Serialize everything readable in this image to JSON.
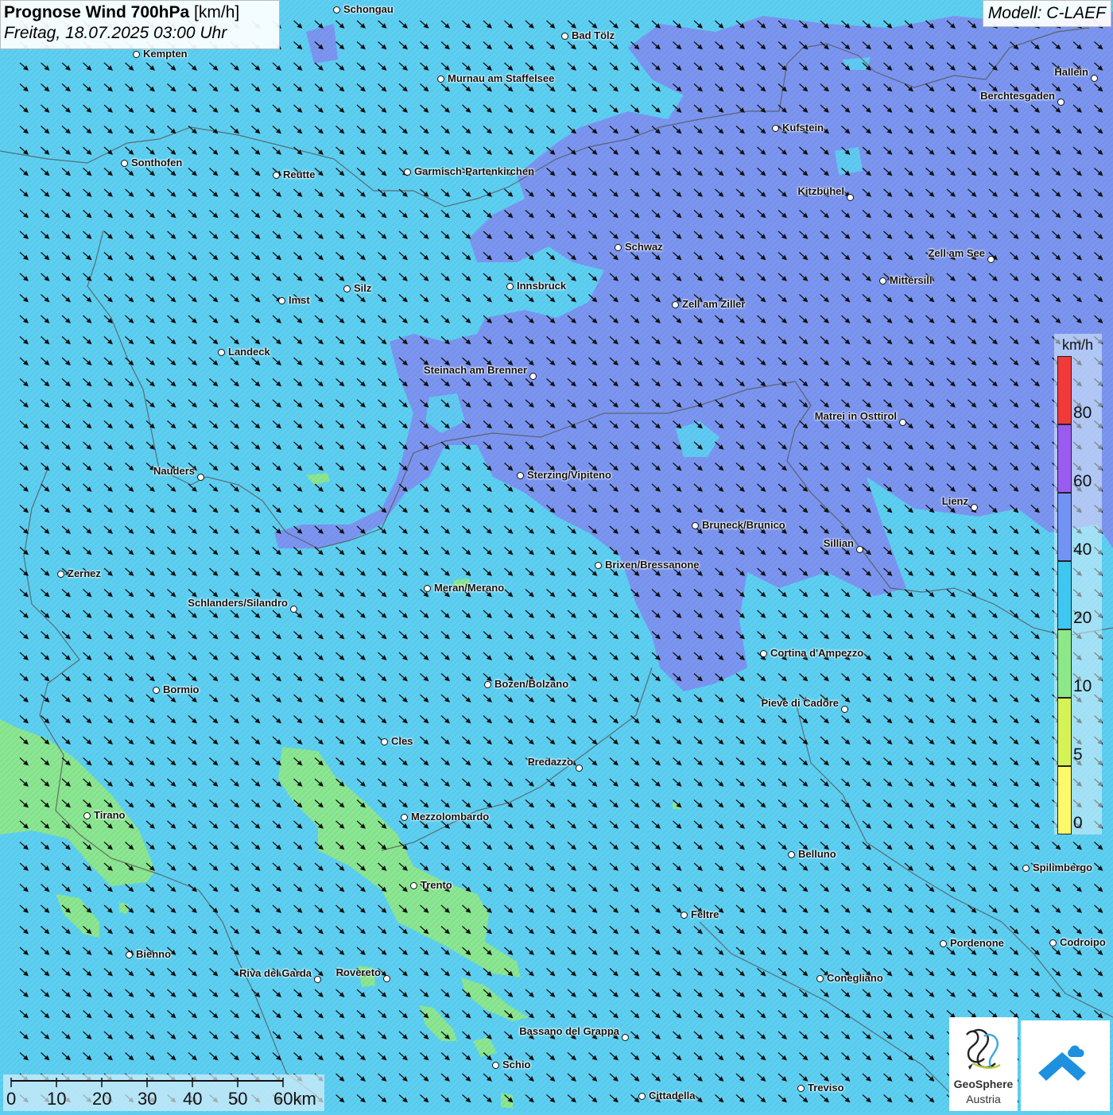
{
  "header": {
    "title_bold": "Prognose Wind 700hPa",
    "title_unit": " [km/h]",
    "subtitle": "Freitag, 18.07.2025 03:00 Uhr"
  },
  "model_label": "Modell: C-LAEF",
  "colors": {
    "base_20_40": "#5dd0f2",
    "band_40_60": "#7f8ff0",
    "band_10_20": "#8de88a",
    "band_5_10": "#d5f257",
    "band_0_5": "#fdf96b",
    "band_60_80": "#9a5cf0",
    "band_80_plus": "#f2393a"
  },
  "legend": {
    "unit": "km/h",
    "stops": [
      {
        "label": "0",
        "color": "#fdf96b"
      },
      {
        "label": "5",
        "color": "#d5f257"
      },
      {
        "label": "10",
        "color": "#8de88a"
      },
      {
        "label": "20",
        "color": "#3ec7f0"
      },
      {
        "label": "40",
        "color": "#7193f3"
      },
      {
        "label": "60",
        "color": "#9a5cf0"
      },
      {
        "label": "80",
        "color": "#f2393a"
      }
    ]
  },
  "wind_arrows": {
    "direction": "north-west wind (arrows pointing south-east)"
  },
  "cities": [
    {
      "name": "Schongau"
    },
    {
      "name": "Bad Tölz"
    },
    {
      "name": "Kempten"
    },
    {
      "name": "Murnau am Staffelsee"
    },
    {
      "name": "Hallein"
    },
    {
      "name": "Berchtesgaden"
    },
    {
      "name": "Kufstein"
    },
    {
      "name": "Sonthofen"
    },
    {
      "name": "Reutte"
    },
    {
      "name": "Garmisch-Partenkirchen"
    },
    {
      "name": "Kitzbühel"
    },
    {
      "name": "Schwaz"
    },
    {
      "name": "Zell am See"
    },
    {
      "name": "Mittersill"
    },
    {
      "name": "Innsbruck"
    },
    {
      "name": "Silz"
    },
    {
      "name": "Imst"
    },
    {
      "name": "Zell am Ziller"
    },
    {
      "name": "Landeck"
    },
    {
      "name": "Steinach am Brenner"
    },
    {
      "name": "Matrei in Osttirol"
    },
    {
      "name": "Nauders"
    },
    {
      "name": "Sterzing/Vipiteno"
    },
    {
      "name": "Lienz"
    },
    {
      "name": "Bruneck/Brunico"
    },
    {
      "name": "Sillian"
    },
    {
      "name": "Brixen/Bressanone"
    },
    {
      "name": "Zernez"
    },
    {
      "name": "Meran/Merano"
    },
    {
      "name": "Schlanders/Silandro"
    },
    {
      "name": "Cortina d'Ampezzo"
    },
    {
      "name": "Bozen/Bolzano"
    },
    {
      "name": "Bormio"
    },
    {
      "name": "Pieve di Cadore"
    },
    {
      "name": "Cles"
    },
    {
      "name": "Predazzo"
    },
    {
      "name": "Tirano"
    },
    {
      "name": "Mezzolombardo"
    },
    {
      "name": "Belluno"
    },
    {
      "name": "Spilimbergo"
    },
    {
      "name": "Trento"
    },
    {
      "name": "Feltre"
    },
    {
      "name": "Pordenone"
    },
    {
      "name": "Codroipo"
    },
    {
      "name": "Bienno"
    },
    {
      "name": "Riva del Garda"
    },
    {
      "name": "Rovereto"
    },
    {
      "name": "Conegliano"
    },
    {
      "name": "Bassano del Grappa"
    },
    {
      "name": "Schio"
    },
    {
      "name": "Treviso"
    },
    {
      "name": "Cittadella"
    }
  ],
  "scale": {
    "labels": [
      "0",
      "10",
      "20",
      "30",
      "40",
      "50",
      "60km"
    ]
  },
  "logos": {
    "geosphere_line1": "GeoSphere",
    "geosphere_line2": "Austria"
  }
}
